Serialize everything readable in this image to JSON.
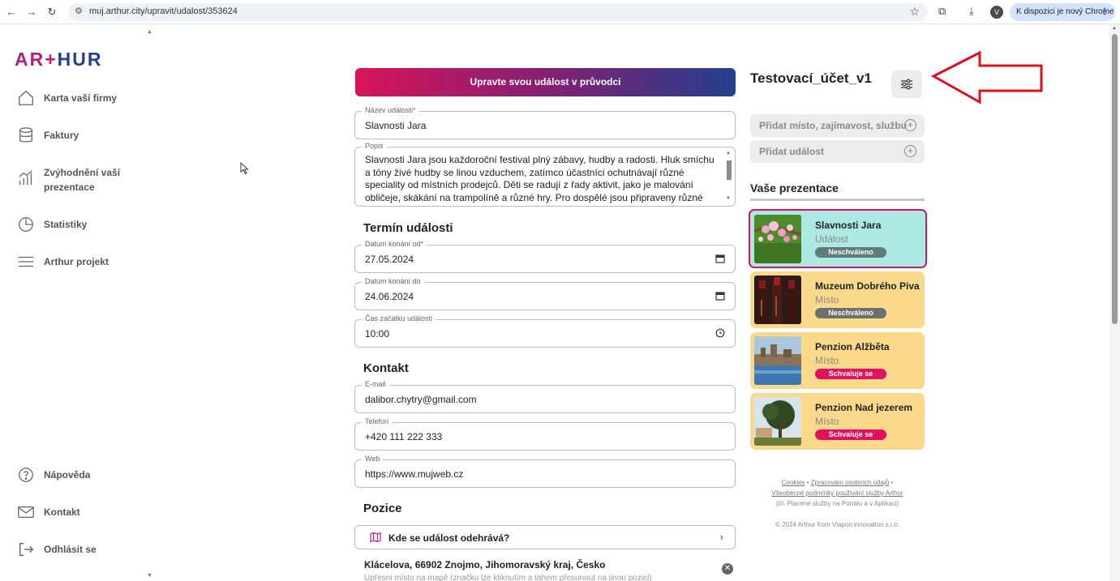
{
  "browser": {
    "url": "muj.arthur.city/upravit/udalost/353624",
    "profile_initial": "V",
    "update_label": "K dispozici je nový Chrome"
  },
  "sidebar": {
    "logo_ar": "AR",
    "logo_plus": "+",
    "logo_hur": "HUR",
    "items": [
      {
        "label": "Karta vaší firmy",
        "icon": "home-icon"
      },
      {
        "label": "Faktury",
        "icon": "database-icon"
      },
      {
        "label": "Zvýhodnění vaší",
        "label2": "prezentace",
        "icon": "bar-chart-icon"
      },
      {
        "label": "Statistiky",
        "icon": "pie-chart-icon"
      },
      {
        "label": "Arthur projekt",
        "icon": "menu-icon"
      }
    ],
    "bottom_items": [
      {
        "label": "Nápověda",
        "icon": "help-icon"
      },
      {
        "label": "Kontakt",
        "icon": "mail-icon"
      },
      {
        "label": "Odhlásit se",
        "icon": "logout-icon"
      }
    ]
  },
  "form": {
    "banner": "Upravte svou událost v průvodci",
    "name": {
      "label": "Název události*",
      "value": "Slavnosti Jara"
    },
    "description": {
      "label": "Popis",
      "value": "Slavnosti Jara jsou každoroční festival plný zábavy, hudby a radosti. Hluk smíchu a tóny živé hudby se linou vzduchem, zatímco účastníci ochutnávají různé speciality od místních prodejců. Děti se radují z řady aktivit, jako je malování obličeje, skákání na trampolíně a různé hry. Pro dospělé jsou připraveny různé soutěže, které nabízejí možnost vyhrát atraktivní ceny. Celkově jsou Slavnosti Jara oslavou komunity, jídla"
    },
    "term_title": "Termín události",
    "date_from": {
      "label": "Datum konání od*",
      "value": "27.05.2024"
    },
    "date_to": {
      "label": "Datum konání do",
      "value": "24.06.2024"
    },
    "start_time": {
      "label": "Čas začátku události",
      "value": "10:00"
    },
    "contact_title": "Kontakt",
    "email": {
      "label": "E-mail",
      "value": "dalibor.chytry@gmail.com"
    },
    "phone": {
      "label": "Telefon",
      "value": "+420 111 222 333"
    },
    "web": {
      "label": "Web",
      "value": "https://www.mujweb.cz"
    },
    "position_title": "Pozice",
    "position_button": "Kde se událost odehrává?",
    "address": "Klácelova, 66902 Znojmo, Jihomoravský kraj, Česko",
    "address_hint": "Upřesni místo na mapě (značku lze kliknutím a tahem přesunout na jinou pozici)"
  },
  "panel": {
    "account": "Testovací_účet_v1",
    "add_place": "Přidat místo, zajímavost, službu",
    "add_event": "Přidat událost",
    "presentations_title": "Vaše prezentace",
    "cards": [
      {
        "name": "Slavnosti Jara",
        "type": "Událost",
        "status": "Neschváleno",
        "status_kind": "no"
      },
      {
        "name": "Muzeum Dobrého Piva",
        "type": "Místo",
        "status": "Neschváleno",
        "status_kind": "no"
      },
      {
        "name": "Penzion Alžběta",
        "type": "Místo",
        "status": "Schvaluje se",
        "status_kind": "wait"
      },
      {
        "name": "Penzion Nad jezerem",
        "type": "Místo",
        "status": "Schvaluje se",
        "status_kind": "wait"
      }
    ],
    "footer": {
      "cookies": "Cookies",
      "sep1": " • ",
      "privacy": "Zpracování osobních údajů",
      "sep2": " •",
      "terms": "Všeobecné podmínky používání služby Arthur",
      "terms_note": "(III. Placené služby na Portálu a v Aplikaci)",
      "copyright": "© 2024 Arthur from Vlapon innovation s.r.o."
    }
  },
  "colors": {
    "brand_pink": "#d4175a",
    "brand_blue": "#23408e",
    "card_yellow": "#fbd98a",
    "card_active": "#aee8e2",
    "arrow_red": "#e0101e"
  }
}
